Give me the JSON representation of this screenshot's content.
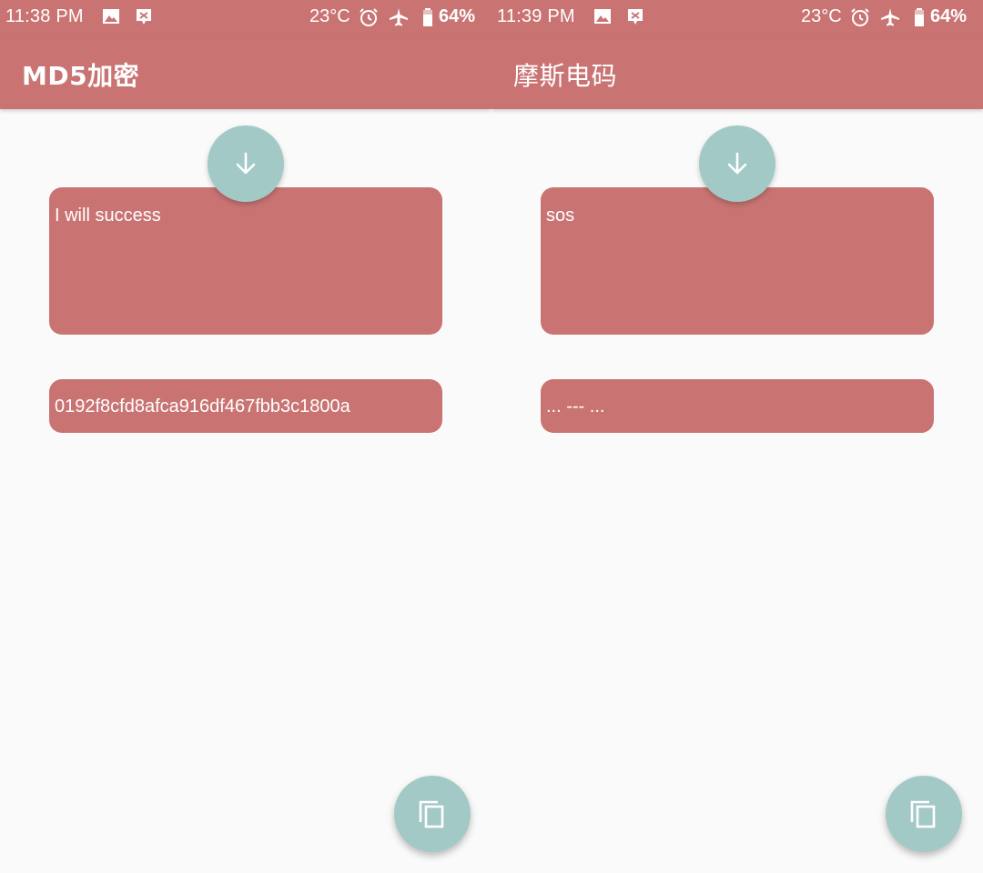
{
  "screens": [
    {
      "status": {
        "time": "11:38 PM",
        "temperature": "23°C",
        "battery": "64%"
      },
      "title": "MD5加密",
      "input_text": "I will success",
      "output_text": "0192f8cfd8afca916df467fbb3c1800a"
    },
    {
      "status": {
        "time": "11:39 PM",
        "temperature": "23°C",
        "battery": "64%"
      },
      "title": "摩斯电码",
      "input_text": "sos",
      "output_text": "... --- ..."
    }
  ],
  "icons": {
    "convert": "arrow-down-icon",
    "copy": "copy-icon",
    "status_left": [
      "image-icon",
      "notification-app-icon"
    ],
    "status_right": [
      "alarm-icon",
      "airplane-icon",
      "battery-icon"
    ]
  },
  "colors": {
    "primary": "#c97473",
    "fab": "#a3c9c7",
    "background": "#fafafa",
    "on_primary": "#ffffff"
  }
}
